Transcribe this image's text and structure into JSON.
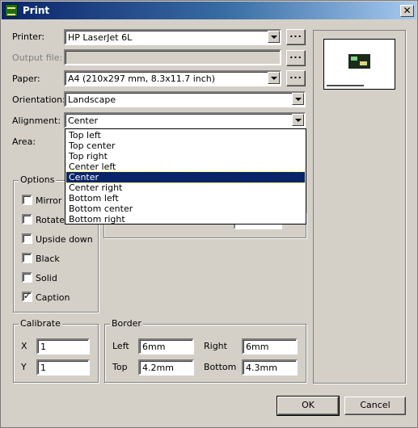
{
  "window": {
    "title": "Print"
  },
  "printer": {
    "label": "Printer:",
    "value": "HP LaserJet 6L",
    "browse": "..."
  },
  "output_file": {
    "label": "Output file:",
    "value": "",
    "browse": "..."
  },
  "paper": {
    "label": "Paper:",
    "value": "A4 (210x297 mm, 8.3x11.7 inch)",
    "browse": "..."
  },
  "orientation": {
    "label": "Orientation:",
    "value": "Landscape"
  },
  "alignment": {
    "label": "Alignment:",
    "value": "Center",
    "options": [
      "Top left",
      "Top center",
      "Top right",
      "Center left",
      "Center",
      "Center right",
      "Bottom left",
      "Bottom center",
      "Bottom right"
    ],
    "selected_index": 4
  },
  "area": {
    "label": "Area:"
  },
  "options": {
    "title": "Options",
    "items": [
      {
        "label": "Mirror",
        "checked": false
      },
      {
        "label": "Rotate",
        "checked": false
      },
      {
        "label": "Upside down",
        "checked": false
      },
      {
        "label": "Black",
        "checked": false
      },
      {
        "label": "Solid",
        "checked": false
      },
      {
        "label": "Caption",
        "checked": true
      }
    ]
  },
  "calibrate": {
    "title": "Calibrate",
    "x_label": "X",
    "x_value": "1",
    "y_label": "Y",
    "y_value": "1"
  },
  "border": {
    "title": "Border",
    "left_label": "Left",
    "left_value": "6mm",
    "right_label": "Right",
    "right_value": "6mm",
    "top_label": "Top",
    "top_value": "4.2mm",
    "bottom_label": "Bottom",
    "bottom_value": "4.3mm"
  },
  "buttons": {
    "ok": "OK",
    "cancel": "Cancel"
  }
}
